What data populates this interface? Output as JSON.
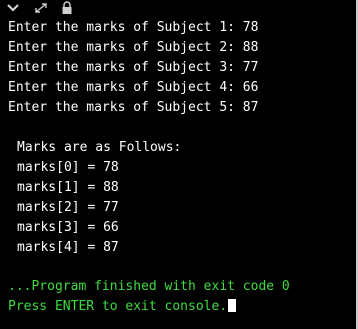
{
  "toolbar": {
    "icons": [
      "chevron-down-icon",
      "expand-icon",
      "lock-icon"
    ]
  },
  "input_lines": [
    "Enter the marks of Subject 1: 78",
    "Enter the marks of Subject 2: 88",
    "Enter the marks of Subject 3: 77",
    "Enter the marks of Subject 4: 66",
    "Enter the marks of Subject 5: 87"
  ],
  "output": {
    "heading": "Marks are as Follows:",
    "rows": [
      "marks[0] = 78",
      "marks[1] = 88",
      "marks[2] = 77",
      "marks[3] = 66",
      "marks[4] = 87"
    ]
  },
  "footer": {
    "exit_message": "...Program finished with exit code 0",
    "prompt": "Press ENTER to exit console."
  },
  "colors": {
    "background": "#000000",
    "text": "#ffffff",
    "status": "#3fdc3f"
  }
}
